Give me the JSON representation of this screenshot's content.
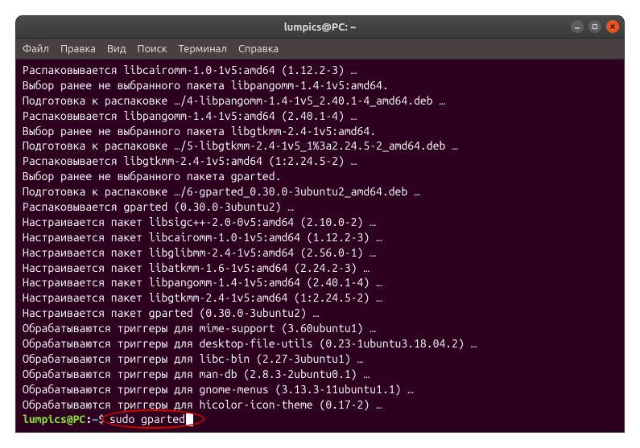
{
  "window": {
    "title": "lumpics@PC: ~"
  },
  "menubar": {
    "items": [
      "Файл",
      "Правка",
      "Вид",
      "Поиск",
      "Терминал",
      "Справка"
    ]
  },
  "terminal": {
    "lines": [
      "Распаковывается libcairomm-1.0-1v5:amd64 (1.12.2-3) …",
      "Выбор ранее не выбранного пакета libpangomm-1.4-1v5:amd64.",
      "Подготовка к распаковке …/4-libpangomm-1.4-1v5_2.40.1-4_amd64.deb …",
      "Распаковывается libpangomm-1.4-1v5:amd64 (2.40.1-4) …",
      "Выбор ранее не выбранного пакета libgtkmm-2.4-1v5:amd64.",
      "Подготовка к распаковке …/5-libgtkmm-2.4-1v5_1%3a2.24.5-2_amd64.deb …",
      "Распаковывается libgtkmm-2.4-1v5:amd64 (1:2.24.5-2) …",
      "Выбор ранее не выбранного пакета gparted.",
      "Подготовка к распаковке …/6-gparted_0.30.0-3ubuntu2_amd64.deb …",
      "Распаковывается gparted (0.30.0-3ubuntu2) …",
      "Настраивается пакет libsigc++-2.0-0v5:amd64 (2.10.0-2) …",
      "Настраивается пакет libcairomm-1.0-1v5:amd64 (1.12.2-3) …",
      "Настраивается пакет libglibmm-2.4-1v5:amd64 (2.56.0-1) …",
      "Настраивается пакет libatkmm-1.6-1v5:amd64 (2.24.2-3) …",
      "Настраивается пакет libpangomm-1.4-1v5:amd64 (2.40.1-4) …",
      "Настраивается пакет libgtkmm-2.4-1v5:amd64 (1:2.24.5-2) …",
      "Настраивается пакет gparted (0.30.0-3ubuntu2) …",
      "Обрабатываются триггеры для mime-support (3.60ubuntu1) …",
      "Обрабатываются триггеры для desktop-file-utils (0.23-1ubuntu3.18.04.2) …",
      "Обрабатываются триггеры для libc-bin (2.27-3ubuntu1) …",
      "Обрабатываются триггеры для man-db (2.8.3-2ubuntu0.1) …",
      "Обрабатываются триггеры для gnome-menus (3.13.3-11ubuntu1.1) …",
      "Обрабатываются триггеры для hicolor-icon-theme (0.17-2) …"
    ],
    "prompt": {
      "user_host": "lumpics@PC",
      "sep": ":",
      "path": "~",
      "dollar": "$",
      "command": "sudo gparted"
    }
  }
}
